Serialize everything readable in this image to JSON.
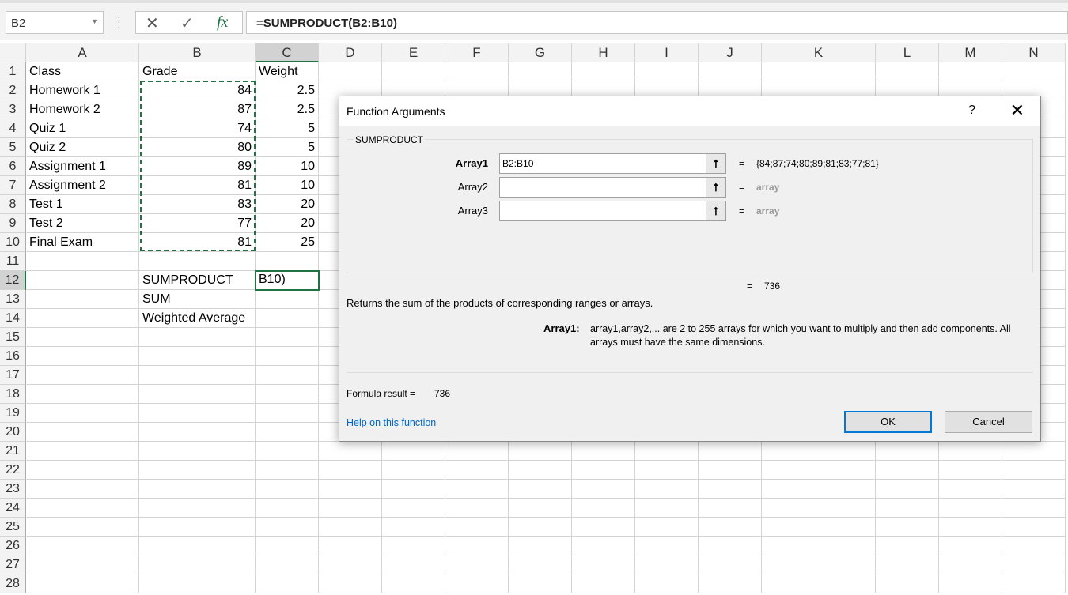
{
  "formula_bar": {
    "name_box": "B2",
    "cancel_icon": "✕",
    "enter_icon": "✓",
    "fx_icon": "fx",
    "formula": "=SUMPRODUCT(B2:B10)"
  },
  "columns": [
    "A",
    "B",
    "C",
    "D",
    "E",
    "F",
    "G",
    "H",
    "I",
    "J",
    "K",
    "L",
    "M",
    "N"
  ],
  "selected_column": "C",
  "selected_row": 12,
  "rows": [
    {
      "A": "Class",
      "B": "Grade",
      "C": "Weight"
    },
    {
      "A": "Homework 1",
      "B": "84",
      "C": "2.5"
    },
    {
      "A": "Homework  2",
      "B": "87",
      "C": "2.5"
    },
    {
      "A": "Quiz 1",
      "B": "74",
      "C": "5"
    },
    {
      "A": "Quiz 2",
      "B": "80",
      "C": "5"
    },
    {
      "A": "Assignment 1",
      "B": "89",
      "C": "10"
    },
    {
      "A": "Assignment 2",
      "B": "81",
      "C": "10"
    },
    {
      "A": "Test 1",
      "B": "83",
      "C": "20"
    },
    {
      "A": "Test 2",
      "B": "77",
      "C": "20"
    },
    {
      "A": "Final Exam",
      "B": "81",
      "C": "25"
    },
    {},
    {
      "B": "SUMPRODUCT",
      "C": "B10)"
    },
    {
      "B": "SUM"
    },
    {
      "B": "Weighted Average"
    },
    {},
    {},
    {},
    {},
    {},
    {},
    {},
    {},
    {},
    {},
    {},
    {},
    {},
    {}
  ],
  "dialog": {
    "title": "Function Arguments",
    "help": "?",
    "close": "✕",
    "function_name": "SUMPRODUCT",
    "args": [
      {
        "label": "Array1",
        "value": "B2:B10",
        "result": "{84;87;74;80;89;81;83;77;81}"
      },
      {
        "label": "Array2",
        "value": "",
        "result": "array"
      },
      {
        "label": "Array3",
        "value": "",
        "result": "array"
      }
    ],
    "eq": "=",
    "total": "736",
    "description": "Returns the sum of the products of corresponding ranges or arrays.",
    "arg_help_label": "Array1:",
    "arg_help_text": "array1,array2,... are 2 to 255 arrays for which you want to multiply and then add components. All arrays must have the same dimensions.",
    "formula_result_label": "Formula result =",
    "formula_result": "736",
    "help_link": "Help on this function",
    "ok": "OK",
    "cancel": "Cancel"
  }
}
